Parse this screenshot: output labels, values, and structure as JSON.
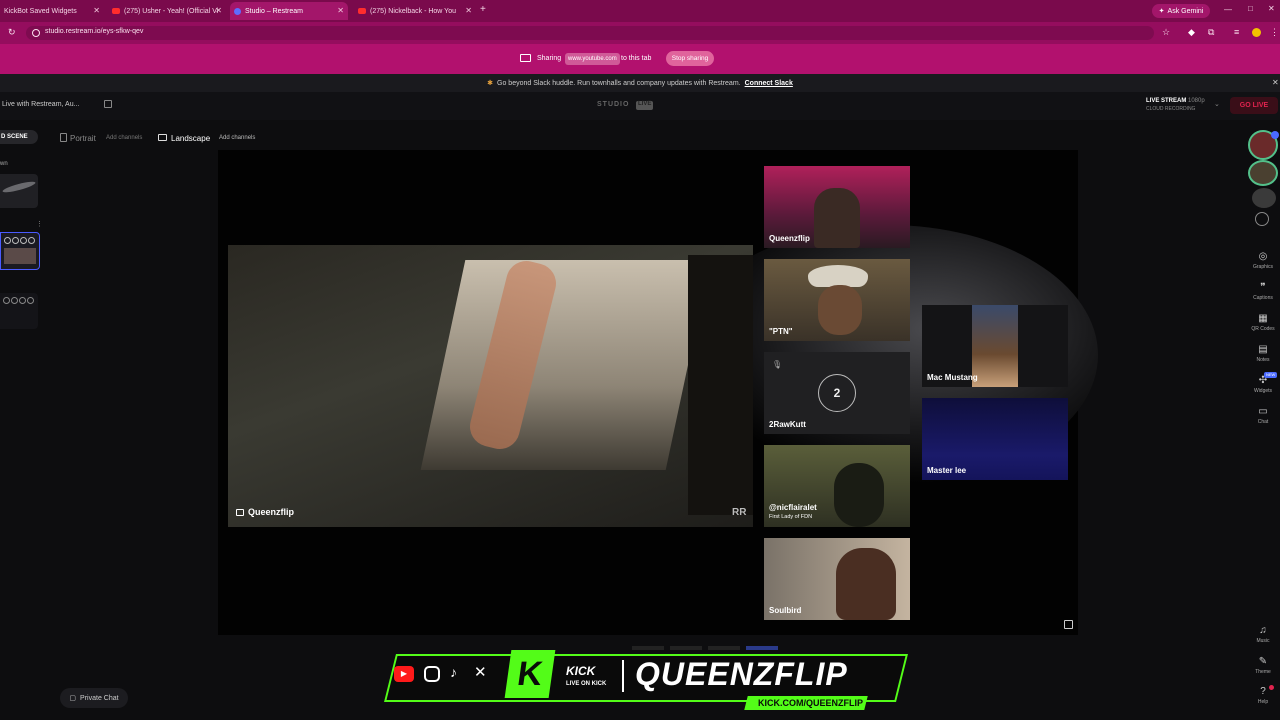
{
  "browser": {
    "tabs": [
      {
        "label": "KickBot Saved Widgets",
        "active": false
      },
      {
        "label": "(275) Usher - Yeah! (Official Vi",
        "active": false
      },
      {
        "label": "Studio – Restream",
        "active": true
      },
      {
        "label": "(275) Nickelback - How You",
        "active": false
      }
    ],
    "ask_gemini": "Ask Gemini",
    "url": "studio.restream.io/eys-sfkw-qev"
  },
  "sharebar": {
    "sharing_label": "Sharing",
    "domain": "www.youtube.com",
    "to_tab": "to this tab",
    "stop_label": "Stop sharing"
  },
  "slack": {
    "message": "Go beyond Slack huddle. Run townhalls and company updates with Restream.",
    "link": "Connect Slack"
  },
  "header": {
    "title": "Live with Restream, Au...",
    "studio_label": "STUDIO",
    "studio_badge": "LIVE",
    "live_stream": "LIVE STREAM",
    "resolution": "1080p",
    "cloud_recording": "CLOUD RECORDING",
    "go_live": "GO LIVE"
  },
  "left": {
    "scene_button": "D SCENE",
    "section_label": "wn"
  },
  "canvas": {
    "portrait": "Portrait",
    "portrait_add": "Add channels",
    "landscape": "Landscape",
    "landscape_add": "Add channels"
  },
  "main_video": {
    "name": "Queenzflip",
    "watermark": "RR"
  },
  "participants": [
    {
      "name": "Queenzflip",
      "sub": ""
    },
    {
      "name": "\"PTN\"",
      "sub": ""
    },
    {
      "name": "2RawKutt",
      "sub": "",
      "avatar": "2"
    },
    {
      "name": "@nicflairalet",
      "sub": "First Lady of FDN"
    },
    {
      "name": "Soulbird",
      "sub": ""
    },
    {
      "name": "Mac Mustang",
      "sub": ""
    },
    {
      "name": "Master lee",
      "sub": ""
    }
  ],
  "right_panel": [
    {
      "label": "Graphics",
      "icon": "palette-icon"
    },
    {
      "label": "Captions",
      "icon": "quote-icon"
    },
    {
      "label": "QR Codes",
      "icon": "qr-icon"
    },
    {
      "label": "Notes",
      "icon": "notes-icon"
    },
    {
      "label": "Widgets",
      "icon": "widgets-icon",
      "badge": "NEW"
    },
    {
      "label": "Chat",
      "icon": "chat-icon"
    },
    {
      "label": "Music",
      "icon": "music-icon"
    },
    {
      "label": "Theme",
      "icon": "theme-icon"
    },
    {
      "label": "Help",
      "icon": "help-icon"
    }
  ],
  "private_chat": "Private Chat",
  "banner": {
    "kick": "KICK",
    "live_on_kick": "LIVE ON KICK",
    "handle": "QUEENZFLIP",
    "url": "KICK.COM/QUEENZFLIP",
    "social_icons": [
      "youtube-icon",
      "instagram-icon",
      "tiktok-icon",
      "x-icon"
    ]
  },
  "colors": {
    "accent": "#b2116e",
    "go_live": "#e0234e",
    "kick_green": "#53fc18"
  }
}
